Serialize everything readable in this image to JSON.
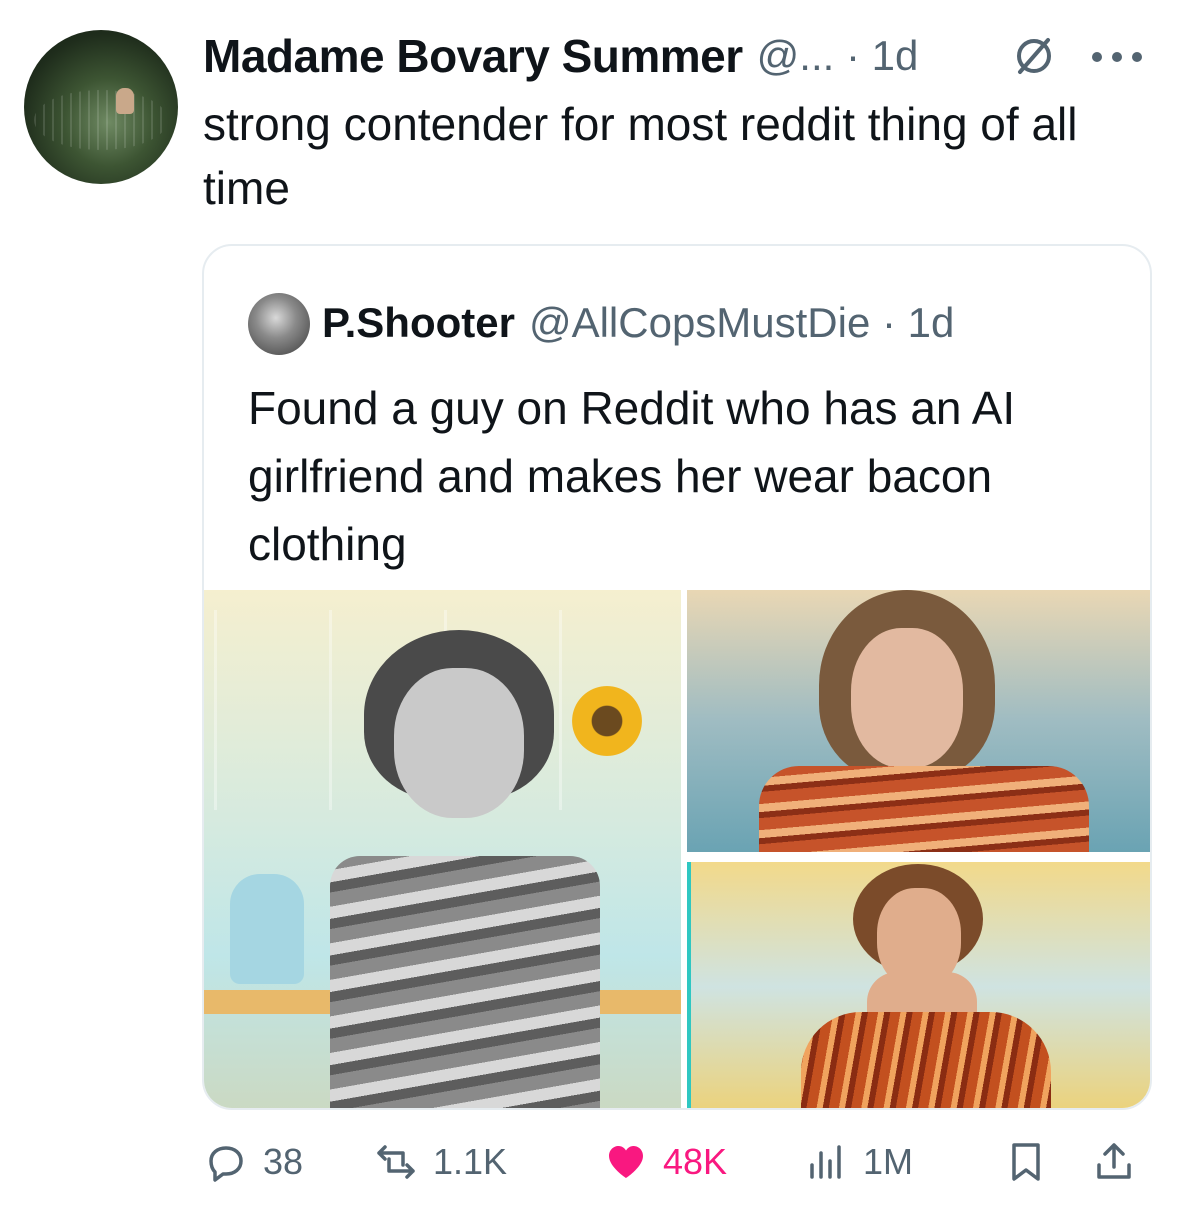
{
  "tweet": {
    "author_name": "Madame Bovary Summer",
    "meta": "@... · 1d",
    "text": "strong contender for most reddit thing of all time"
  },
  "quoted": {
    "author_name": "P.Shooter",
    "meta": "@AllCopsMustDie · 1d",
    "text": "Found a guy on Reddit who has an AI girlfriend and makes her wear bacon clothing",
    "images": [
      "image-1",
      "image-2",
      "image-3"
    ]
  },
  "actions": {
    "replies": "38",
    "retweets": "1.1K",
    "likes": "48K",
    "views": "1M"
  },
  "colors": {
    "text": "#0f1419",
    "secondary": "#536471",
    "like": "#f91880",
    "border": "#e6ecf0"
  },
  "icons": [
    "no-symbol-icon",
    "more-icon",
    "reply-icon",
    "retweet-icon",
    "heart-icon",
    "views-icon",
    "bookmark-icon",
    "share-icon"
  ]
}
